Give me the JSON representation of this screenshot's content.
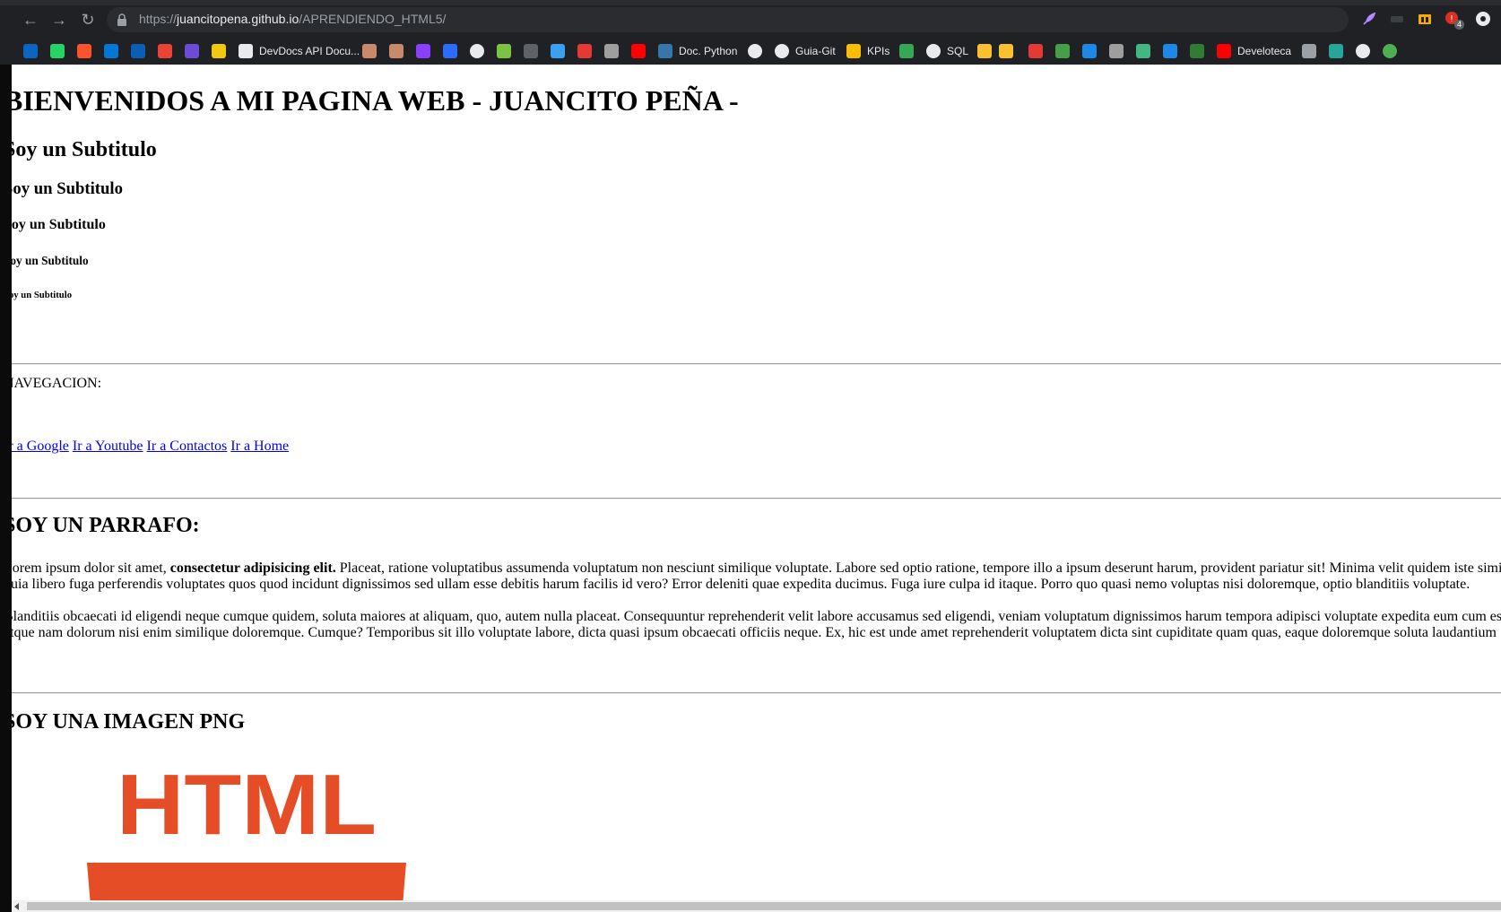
{
  "browser": {
    "url_scheme": "https://",
    "url_host": "juancitopena.github.io",
    "url_path": "/APRENDIENDO_HTML5/",
    "badge_count": "4",
    "bookmarks": [
      {
        "name": "linkedin-icon",
        "label": "",
        "color": "#0a66c2"
      },
      {
        "name": "whatsapp-icon",
        "label": "",
        "color": "#25d366"
      },
      {
        "name": "brave-icon",
        "label": "",
        "color": "#fb542b"
      },
      {
        "name": "outlook-icon",
        "label": "",
        "color": "#0078d4"
      },
      {
        "name": "outlook-icon",
        "label": "",
        "color": "#0a5fb4"
      },
      {
        "name": "gmail-icon",
        "label": "",
        "color": "#ea4335"
      },
      {
        "name": "app-icon",
        "label": "",
        "color": "#6c4cd6"
      },
      {
        "name": "power-bi-icon",
        "label": "",
        "color": "#f2c811"
      },
      {
        "name": "devdocs-icon",
        "label": "DevDocs API Docu...",
        "color": "#e8eaed"
      },
      {
        "name": "person-icon",
        "label": "",
        "color": "#c98a6b"
      },
      {
        "name": "person-icon",
        "label": "",
        "color": "#c98a6b"
      },
      {
        "name": "app-icon",
        "label": "",
        "color": "#8a3ffc"
      },
      {
        "name": "app-icon",
        "label": "",
        "color": "#2b6cff"
      },
      {
        "name": "globe-icon",
        "label": "",
        "color": "#e8eaed"
      },
      {
        "name": "app-icon",
        "label": "",
        "color": "#7cc243"
      },
      {
        "name": "app-icon",
        "label": "",
        "color": "#5f6368"
      },
      {
        "name": "app-icon",
        "label": "",
        "color": "#38a1f3"
      },
      {
        "name": "app-icon",
        "label": "",
        "color": "#e53935"
      },
      {
        "name": "app-icon",
        "label": "",
        "color": "#9e9e9e"
      },
      {
        "name": "youtube-icon",
        "label": "",
        "color": "#ff0000"
      },
      {
        "name": "python-icon",
        "label": "Doc. Python",
        "color": "#3776ab"
      },
      {
        "name": "globe-icon",
        "label": "",
        "color": "#e8eaed"
      },
      {
        "name": "globe-icon",
        "label": "Guia-Git",
        "color": "#e8eaed"
      },
      {
        "name": "kpis-icon",
        "label": "KPIs",
        "color": "#fbbc04"
      },
      {
        "name": "maps-icon",
        "label": "",
        "color": "#34a853"
      },
      {
        "name": "globe-icon",
        "label": "SQL",
        "color": "#e8eaed"
      },
      {
        "name": "emoji-icon",
        "label": "",
        "color": "#fbc02d"
      },
      {
        "name": "emoji-icon",
        "label": "",
        "color": "#fbc02d"
      },
      {
        "name": "app-icon",
        "label": "",
        "color": "#e53935"
      },
      {
        "name": "app-icon",
        "label": "",
        "color": "#43a047"
      },
      {
        "name": "app-icon",
        "label": "",
        "color": "#1e88e5"
      },
      {
        "name": "app-icon",
        "label": "",
        "color": "#9e9e9e"
      },
      {
        "name": "vue-icon",
        "label": "",
        "color": "#41b883"
      },
      {
        "name": "app-icon",
        "label": "",
        "color": "#1e88e5"
      },
      {
        "name": "app-icon",
        "label": "",
        "color": "#2e7d32"
      },
      {
        "name": "youtube-icon",
        "label": "Develoteca",
        "color": "#ff0000"
      },
      {
        "name": "shield-icon",
        "label": "",
        "color": "#9aa0a6"
      },
      {
        "name": "app-icon",
        "label": "",
        "color": "#26a69a"
      },
      {
        "name": "globe-icon",
        "label": "",
        "color": "#e8eaed"
      },
      {
        "name": "globe-icon",
        "label": "",
        "color": "#4caf50"
      }
    ]
  },
  "page": {
    "h1": "BIENVENIDOS A MI PAGINA WEB - JUANCITO PEÑA -",
    "h2": "Soy un Subtitulo",
    "h3": "Soy un Subtitulo",
    "h4": "Soy un Subtitulo",
    "h5": "Soy un Subtitulo",
    "h6": "Soy un Subtitulo",
    "nav_label": "NAVEGACION:",
    "links": [
      "Ir a Google",
      "Ir a Youtube",
      "Ir a Contactos",
      "Ir a Home"
    ],
    "para_title": "SOY UN PARRAFO:",
    "para1_start": "Lorem ipsum dolor sit amet, ",
    "para1_bold": "consectetur adipisicing elit.",
    "para1_rest": " Placeat, ratione voluptatibus assumenda voluptatum non nesciunt similique voluptate. Labore sed optio ratione, tempore illo a ipsum deserunt harum, provident pariatur sit! Minima velit quidem iste similique",
    "para1_line2": "quia libero fuga perferendis voluptates quos quod incidunt dignissimos sed ullam esse debitis harum facilis id vero? Error deleniti quae expedita ducimus. Fuga iure culpa id itaque. Porro quo quasi nemo voluptas nisi doloremque, optio blanditiis voluptate.",
    "para2_line1": "Blanditiis obcaecati id eligendi neque cumque quidem, soluta maiores at aliquam, quo, autem nulla placeat. Consequuntur reprehenderit velit labore accusamus sed eligendi, veniam voluptatum dignissimos harum tempora adipisci voluptate expedita eum cum esse",
    "para2_line2": "atque nam dolorum nisi enim similique doloremque. Cumque? Temporibus sit illo voluptate labore, dicta quasi ipsum obcaecati officiis neque. Ex, hic est unde amet reprehenderit voluptatem dicta sint cupiditate quam quas, eaque doloremque soluta laudantium",
    "img_title": "SOY UNA IMAGEN PNG",
    "logo_text": "HTML",
    "logo_color": "#e44d26"
  }
}
